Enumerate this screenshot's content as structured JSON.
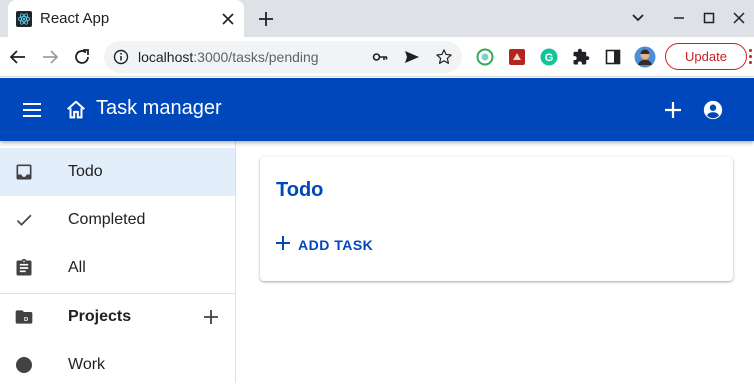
{
  "browser": {
    "tab": {
      "title": "React App"
    },
    "address": {
      "host": "localhost",
      "path": ":3000/tasks/pending"
    },
    "update_label": "Update"
  },
  "app": {
    "title": "Task manager",
    "primary_color": "#0047bb"
  },
  "drawer": {
    "items": [
      {
        "label": "Todo",
        "icon": "inbox-icon",
        "selected": true
      },
      {
        "label": "Completed",
        "icon": "check-icon"
      },
      {
        "label": "All",
        "icon": "clipboard-icon"
      }
    ],
    "projects_header": {
      "label": "Projects",
      "icon": "folder-icon"
    },
    "projects": [
      {
        "label": "Work",
        "icon": "circle-icon"
      }
    ]
  },
  "main": {
    "card_title": "Todo",
    "add_task_label": "ADD TASK"
  }
}
